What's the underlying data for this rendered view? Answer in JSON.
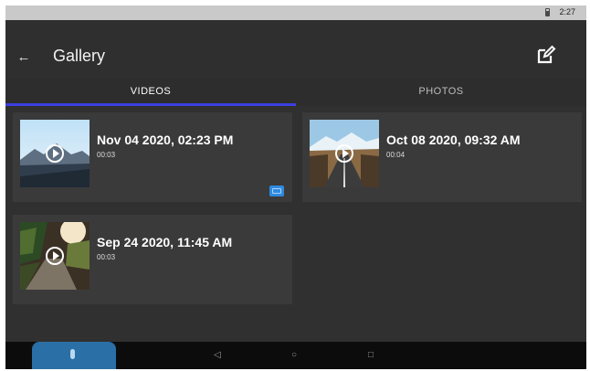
{
  "status_bar": {
    "time": "2:27"
  },
  "app_bar": {
    "title": "Gallery",
    "back_icon": "arrow-left-icon",
    "edit_icon": "edit-square-icon"
  },
  "tabs": [
    {
      "label": "VIDEOS",
      "active": true
    },
    {
      "label": "PHOTOS",
      "active": false
    }
  ],
  "videos": [
    {
      "title": "Nov 04 2020, 02:23 PM",
      "duration": "00:03",
      "badge": "storage-icon"
    },
    {
      "title": "Oct 08 2020, 09:32 AM",
      "duration": "00:04"
    },
    {
      "title": "Sep 24 2020, 11:45 AM",
      "duration": "00:03"
    }
  ],
  "nav_bar": {
    "mic_icon": "mic-icon",
    "back_icon": "triangle-back-icon",
    "home_icon": "circle-home-icon",
    "recent_icon": "square-recent-icon"
  },
  "colors": {
    "tab_indicator": "#3b3fe0",
    "badge": "#2f8ae0",
    "mic_button": "#2a6fa6",
    "background": "#2f2f2f"
  }
}
